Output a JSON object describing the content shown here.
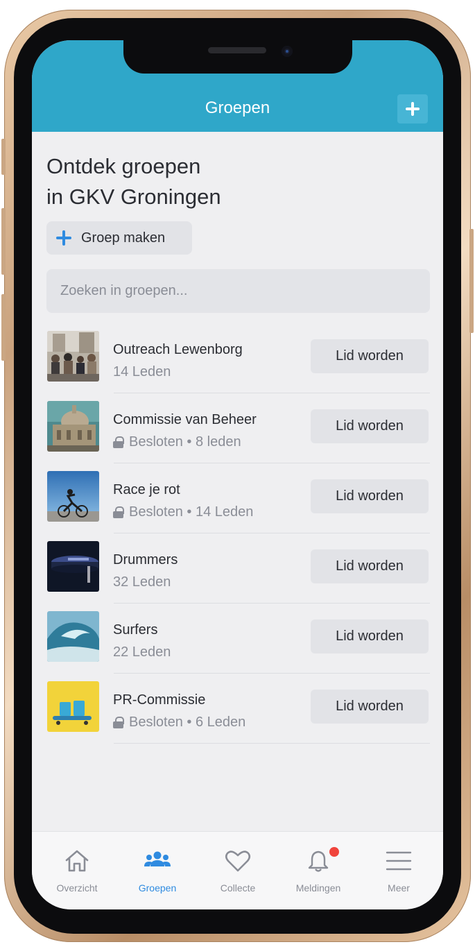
{
  "header": {
    "title": "Groepen",
    "add_icon": "plus-icon"
  },
  "page": {
    "title_line1": "Ontdek groepen",
    "title_line2": "in GKV Groningen",
    "create_group_label": "Groep maken",
    "search_placeholder": "Zoeken in groepen..."
  },
  "groups": [
    {
      "name": "Outreach Lewenborg",
      "meta": "14 Leden",
      "locked": false,
      "join_label": "Lid worden",
      "thumb": "street-crowd"
    },
    {
      "name": "Commissie van Beheer",
      "meta": "Besloten • 8 leden",
      "locked": true,
      "join_label": "Lid worden",
      "thumb": "church-building"
    },
    {
      "name": "Race je rot",
      "meta": "Besloten • 14 Leden",
      "locked": true,
      "join_label": "Lid worden",
      "thumb": "cyclist"
    },
    {
      "name": "Drummers",
      "meta": "32 Leden",
      "locked": false,
      "join_label": "Lid worden",
      "thumb": "drum"
    },
    {
      "name": "Surfers",
      "meta": "22 Leden",
      "locked": false,
      "join_label": "Lid worden",
      "thumb": "wave"
    },
    {
      "name": "PR-Commissie",
      "meta": "Besloten • 6 Leden",
      "locked": true,
      "join_label": "Lid worden",
      "thumb": "yellow-products"
    }
  ],
  "tabs": [
    {
      "label": "Overzicht",
      "icon": "home-icon",
      "active": false
    },
    {
      "label": "Groepen",
      "icon": "people-icon",
      "active": true
    },
    {
      "label": "Collecte",
      "icon": "heart-icon",
      "active": false
    },
    {
      "label": "Meldingen",
      "icon": "bell-icon",
      "active": false,
      "badge": true
    },
    {
      "label": "Meer",
      "icon": "menu-icon",
      "active": false
    }
  ],
  "colors": {
    "header": "#2fa7c9",
    "accent": "#2f8be0",
    "badge": "#f0443c",
    "frame": "#c9a27e"
  }
}
